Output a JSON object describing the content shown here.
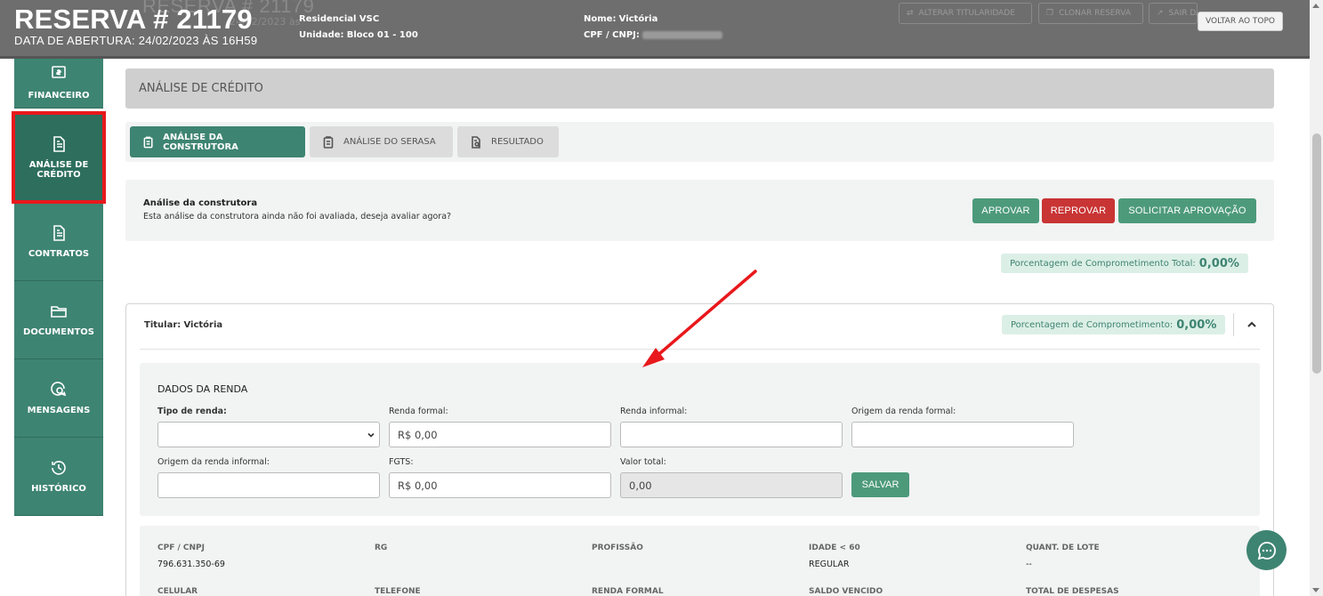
{
  "header": {
    "reservation_title": "RESERVA # 21179",
    "ghost_title": "RESERVA # 21179",
    "ghost_date": "24/02/2023 às",
    "opening_date": "DATA DE ABERTURA: 24/02/2023 ÀS 16H59",
    "development_label": "Residencial VSC",
    "unit_prefix": "Unidade:",
    "unit_value": "Bloco 01 - 100",
    "name_prefix": "Nome:",
    "name_value": "Victória",
    "cpf_prefix": "CPF / CNPJ:",
    "ghost_buttons": [
      "ALTERAR TITULARIDADE",
      "CLONAR RESERVA",
      "SAIR DA RESERVA"
    ],
    "back_to_top": "VOLTAR AO TOPO"
  },
  "sidebar": {
    "items": [
      {
        "label": "FINANCEIRO",
        "icon": "money-icon"
      },
      {
        "label": "ANÁLISE DE CRÉDITO",
        "icon": "document-icon"
      },
      {
        "label": "CONTRATOS",
        "icon": "document-icon"
      },
      {
        "label": "DOCUMENTOS",
        "icon": "folder-icon"
      },
      {
        "label": "MENSAGENS",
        "icon": "chat-search-icon"
      },
      {
        "label": "HISTÓRICO",
        "icon": "history-icon"
      }
    ]
  },
  "main": {
    "section_title": "ANÁLISE DE CRÉDITO",
    "tabs": [
      {
        "label": "ANÁLISE DA CONSTRUTORA",
        "active": true
      },
      {
        "label": "ANÁLISE DO SERASA",
        "active": false
      },
      {
        "label": "RESULTADO",
        "active": false
      }
    ],
    "evaluation": {
      "title": "Análise da construtora",
      "subtitle": "Esta análise da construtora ainda não foi avaliada, deseja avaliar agora?",
      "approve": "APROVAR",
      "reject": "REPROVAR",
      "request": "SOLICITAR APROVAÇÃO"
    },
    "total_commitment": {
      "label": "Porcentagem de Comprometimento Total:",
      "value": "0,00%"
    },
    "holder": {
      "prefix": "Titular:",
      "name": "Victória",
      "commitment_label": "Porcentagem de Comprometimento:",
      "commitment_value": "0,00%"
    },
    "income": {
      "title": "DADOS DA RENDA",
      "income_type_label": "Tipo de renda:",
      "income_type_value": "",
      "formal_label": "Renda formal:",
      "formal_value": "R$ 0,00",
      "informal_label": "Renda informal:",
      "informal_value": "",
      "formal_origin_label": "Origem da renda formal:",
      "formal_origin_value": "",
      "informal_origin_label": "Origem da renda informal:",
      "informal_origin_value": "",
      "fgts_label": "FGTS:",
      "fgts_value": "R$ 0,00",
      "total_label": "Valor total:",
      "total_value": "0,00",
      "save": "SALVAR"
    },
    "personal": {
      "row1": [
        {
          "label": "CPF / CNPJ",
          "value": "796.631.350-69"
        },
        {
          "label": "RG",
          "value": ""
        },
        {
          "label": "PROFISSÃO",
          "value": ""
        },
        {
          "label": "IDADE < 60",
          "value": "REGULAR"
        },
        {
          "label": "QUANT. DE LOTE",
          "value": "--"
        }
      ],
      "row2": [
        {
          "label": "CELULAR"
        },
        {
          "label": "TELEFONE"
        },
        {
          "label": "RENDA FORMAL"
        },
        {
          "label": "SALDO VENCIDO"
        },
        {
          "label": "TOTAL DE DESPESAS"
        }
      ]
    }
  },
  "colors": {
    "primary_green": "#3e8472",
    "button_green": "#4d9a7b",
    "danger_red": "#c93434",
    "highlight_red": "#e8181c",
    "header_gray": "#6e6e6e"
  }
}
